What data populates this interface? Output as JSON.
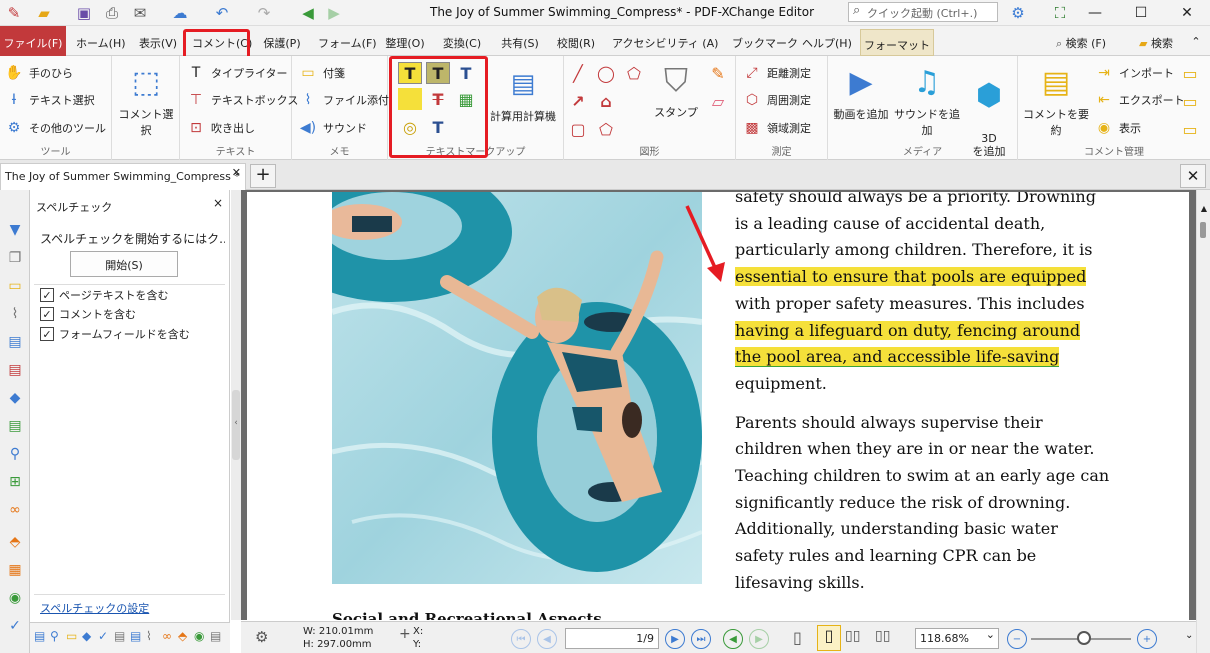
{
  "window": {
    "title": "The Joy of Summer Swimming_Compress* - PDF-XChange Editor",
    "quick_launch_placeholder": "クイック起動 (Ctrl+.)"
  },
  "menu": {
    "tabs": [
      "ファイル(F)",
      "ホーム(H)",
      "表示(V)",
      "コメント(C)",
      "保護(P)",
      "フォーム(F)",
      "整理(O)",
      "変換(C)",
      "共有(S)",
      "校閲(R)",
      "アクセシビリティ (A)",
      "ブックマーク",
      "ヘルプ(H)",
      "フォーマット"
    ],
    "search1": "検索 (F)",
    "search2": "検索"
  },
  "ribbon": {
    "tools": {
      "label": "ツール",
      "items": [
        "手のひら",
        "テキスト選択",
        "その他のツール"
      ]
    },
    "comment_select": "コメント選択",
    "text": {
      "label": "テキスト",
      "items": [
        "タイプライター",
        "テキストボックス",
        "吹き出し"
      ]
    },
    "memo": {
      "label": "メモ",
      "items": [
        "付箋",
        "ファイル添付",
        "サウンド"
      ]
    },
    "markup": {
      "label": "テキストマークアップ"
    },
    "calc": "計算用計算機",
    "shapes": {
      "label": "図形"
    },
    "stamp": "スタンプ",
    "measure": {
      "label": "測定",
      "items": [
        "距離測定",
        "周囲測定",
        "領域測定"
      ]
    },
    "media": {
      "label": "メディア",
      "items": [
        "動画を追加",
        "サウンドを追加",
        "3D\nを追加"
      ]
    },
    "summary": "コメントを要約",
    "manage": {
      "label": "コメント管理",
      "items": [
        "インポート",
        "エクスポート",
        "表示"
      ]
    }
  },
  "doc_tab": {
    "title": "The Joy of Summer Swimming_Compress *"
  },
  "spell_panel": {
    "title": "スペルチェック",
    "message": "スペルチェックを開始するにはク...",
    "start_button": "開始(S)",
    "options": [
      "ページテキストを含む",
      "コメントを含む",
      "フォームフィールドを含む"
    ],
    "settings_link": "スペルチェックの設定"
  },
  "document": {
    "para1_lines": [
      "safety should always be a priority. Drowning",
      "is a leading cause of accidental death,",
      "particularly among children. Therefore, it is"
    ],
    "hl1": "essential to ensure that pools are equipped",
    "para1_mid": "with proper safety measures. This includes",
    "hl2a": "having a lifeguard on duty, fencing around",
    "hl2b": "the pool area, and accessible life-saving",
    "para1_end": "equipment.",
    "para2_lines": [
      "Parents should always supervise their",
      "children when they are in or near the water.",
      "Teaching children to swim at an early age can",
      "significantly reduce the risk of drowning.",
      "Additionally, understanding basic water",
      "safety rules and learning CPR can be",
      "lifesaving skills."
    ],
    "next_heading": "Social and Recreational Aspects"
  },
  "status": {
    "width": "W: 210.01mm",
    "height": "H: 297.00mm",
    "x": "X:",
    "y": "Y:",
    "page": "1/9",
    "zoom": "118.68%"
  },
  "colors": {
    "highlight": "#f5e03a",
    "annotation_red": "#e51c23",
    "file_tab": "#c2393b"
  }
}
